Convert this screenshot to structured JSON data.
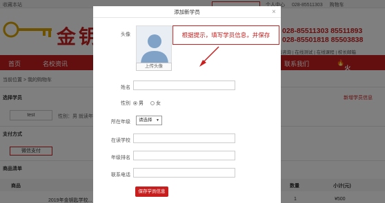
{
  "topbar": {
    "favorite": "收藏本站",
    "links": [
      "个人中心",
      "028-85511303",
      "购物车"
    ]
  },
  "header": {
    "brand": "金钥",
    "phones": [
      "028-85511303 85511893",
      "028-85501818 85503838"
    ],
    "quick_links": "在线咨询 | 在线测试 | 在线课程 | 校长邮箱"
  },
  "nav": {
    "items": [
      "首页",
      "名校资讯",
      "联系我们"
    ],
    "apply": "火速报名"
  },
  "breadcrumb": "当前位置 > 我的购物车",
  "cart": {
    "select_student_heading": "选择学员",
    "new_student_link": "新增学员信息",
    "student_name": "test",
    "student_meta": "性别：男  就读年级",
    "payment_heading": "支付方式",
    "wechat_pay": "微信支付",
    "goods_heading": "商品清单",
    "col_product": "商品",
    "col_quantity": "数量",
    "col_subtotal": "小计(元)",
    "row_product": "2019年金钥匙学校...",
    "row_quantity": "1",
    "row_subtotal": "¥500"
  },
  "modal": {
    "title": "添加新学员",
    "close": "×",
    "avatar_label": "头像",
    "upload_button": "上传头像",
    "hint": "根据提示，填写学员信息，并保存",
    "name_label": "姓名",
    "gender_label": "性别",
    "gender_male": "男",
    "gender_female": "女",
    "gender_selected": "男",
    "grade_label": "所在年级",
    "grade_select": "请选择",
    "school_label": "在读学校",
    "class_label": "年级排名",
    "phone_label": "联系电话",
    "save_button": "保存学员信息"
  },
  "colors": {
    "brand_red": "#c81e1e",
    "overlay": "rgba(0,0,0,0.5)"
  }
}
